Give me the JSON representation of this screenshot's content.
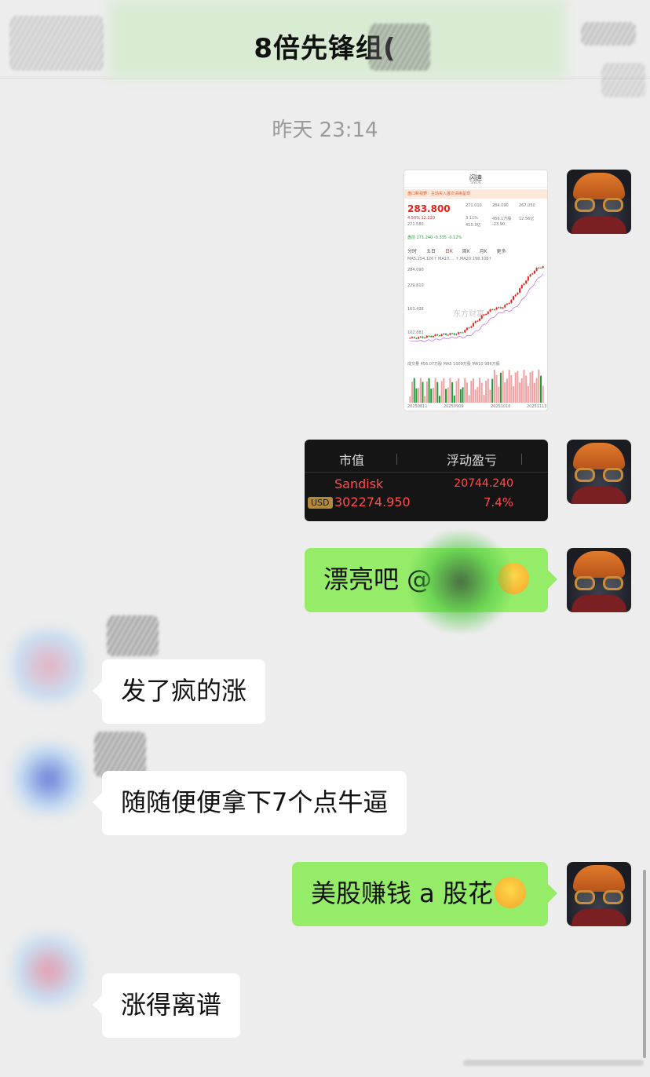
{
  "header": {
    "title": "8倍先锋组("
  },
  "timestamp": "昨天 23:14",
  "stock_screenshot": {
    "stock_name": "闪迪",
    "ticker": "SNDK",
    "banner": "盘口新视野：主动买入首次清晰呈现",
    "price": "283.800",
    "change": "4.50%  12.220",
    "open": "271.010",
    "high": "284.090",
    "low": "267.050",
    "prev_close": "271.580",
    "turnover": "3.11%",
    "volume": "456.1万股",
    "amount": "12.56亿",
    "market_cap": "415.3亿",
    "pe": "-23.90",
    "premarket": "盘前  271.240  -0.335  -0.12%",
    "tabs": [
      "分时",
      "五日",
      "日K",
      "周K",
      "月K",
      "更多"
    ],
    "ma_line": "MA5:254.126↑  MA10:... ↑  MA20:198.108↑",
    "watermark": "东方财富",
    "vol_line": "成交量  456.07万股  MA5 1009万股  MA10 986万股",
    "dates": [
      "20250811",
      "20250909",
      "20251010",
      "20251113"
    ],
    "y_ticks": [
      "284.090",
      "229.810",
      "163.438",
      "102.881"
    ],
    "chart_data": {
      "type": "candlestick",
      "title": "闪迪 SNDK 日K",
      "x": [
        "20250811",
        "20250909",
        "20251010",
        "20251113"
      ],
      "close": [
        70,
        82,
        160,
        283.8
      ],
      "ylim": [
        50,
        290
      ],
      "volume_unit": "万股"
    }
  },
  "position_card": {
    "header_market_value": "市值",
    "header_pl": "浮动盈亏",
    "name": "Sandisk",
    "pl_value": "20744.240",
    "currency": "USD",
    "market_value": "302274.950",
    "pl_percent": "7.4%",
    "accent": "#ff4d4f"
  },
  "messages": [
    {
      "side": "out",
      "text": "漂亮吧 @",
      "emoji": "rofl"
    },
    {
      "side": "in",
      "text": "发了疯的涨"
    },
    {
      "side": "in",
      "text": "随随便便拿下7个点牛逼"
    },
    {
      "side": "out",
      "text": "美股赚钱 a 股花",
      "emoji": "sob"
    },
    {
      "side": "in",
      "text": "涨得离谱"
    }
  ],
  "colors": {
    "bubble_out": "#95ec69",
    "bubble_in": "#ffffff",
    "background": "#ededed"
  }
}
